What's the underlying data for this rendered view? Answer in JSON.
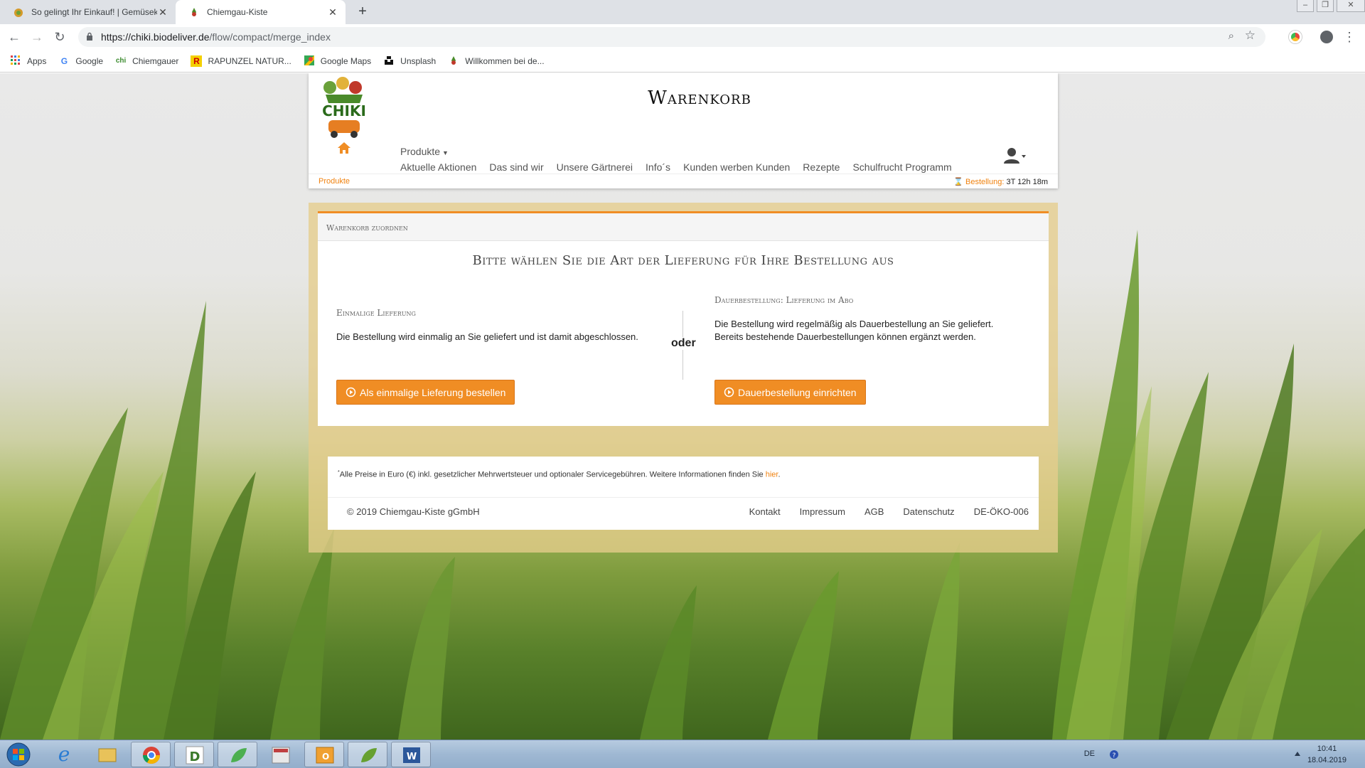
{
  "browser": {
    "tabs": [
      {
        "title": "So gelingt Ihr Einkauf! | Gemüsek",
        "active": false
      },
      {
        "title": "Chiemgau-Kiste",
        "active": true
      }
    ],
    "url_host": "https://chiki.biodeliver.de",
    "url_path": "/flow/compact/merge_index",
    "bookmarks": [
      {
        "label": "Apps",
        "icon": "apps-grid-icon"
      },
      {
        "label": "Google",
        "icon": "google-icon"
      },
      {
        "label": "Chiemgauer",
        "icon": "chiemgauer-icon"
      },
      {
        "label": "RAPUNZEL NATUR...",
        "icon": "rapunzel-icon"
      },
      {
        "label": "Google Maps",
        "icon": "maps-icon"
      },
      {
        "label": "Unsplash",
        "icon": "unsplash-icon"
      },
      {
        "label": "Willkommen bei de...",
        "icon": "chiki-icon"
      }
    ]
  },
  "site": {
    "title": "Warenkorb",
    "nav_dropdown": "Produkte",
    "nav": [
      "Aktuelle Aktionen",
      "Das sind wir",
      "Unsere Gärtnerei",
      "Info´s",
      "Kunden werben Kunden",
      "Rezepte",
      "Schulfrucht Programm"
    ],
    "breadcrumb": "Produkte",
    "countdown_label": "Bestellung:",
    "countdown_value": "3T 12h 18m"
  },
  "card": {
    "header": "Warenkorb zuordnen",
    "title": "Bitte wählen Sie die Art der Lieferung für Ihre Bestellung aus",
    "left": {
      "title": "Einmalige Lieferung",
      "text": "Die Bestellung wird einmalig an Sie geliefert und ist damit abgeschlossen.",
      "button": "Als einmalige Lieferung bestellen"
    },
    "separator": "oder",
    "right": {
      "title": "Dauerbestellung: Lieferung im Abo",
      "text1": "Die Bestellung wird regelmäßig als Dauerbestellung an Sie geliefert.",
      "text2": "Bereits bestehende Dauerbestellungen können ergänzt werden.",
      "button": "Dauerbestellung einrichten"
    }
  },
  "footer": {
    "note_mark": "*",
    "note": "Alle Preise in Euro (€) inkl. gesetzlicher Mehrwertsteuer und optionaler Servicegebühren.  Weitere Informationen finden Sie ",
    "note_link": "hier",
    "note_end": ".",
    "copyright": "© 2019 Chiemgau-Kiste gGmbH",
    "links": [
      "Kontakt",
      "Impressum",
      "AGB",
      "Datenschutz",
      "DE-ÖKO-006"
    ]
  },
  "taskbar": {
    "lang": "DE",
    "time": "10:41",
    "date": "18.04.2019"
  },
  "colors": {
    "accent": "#f08d24",
    "link": "#f0820f"
  }
}
